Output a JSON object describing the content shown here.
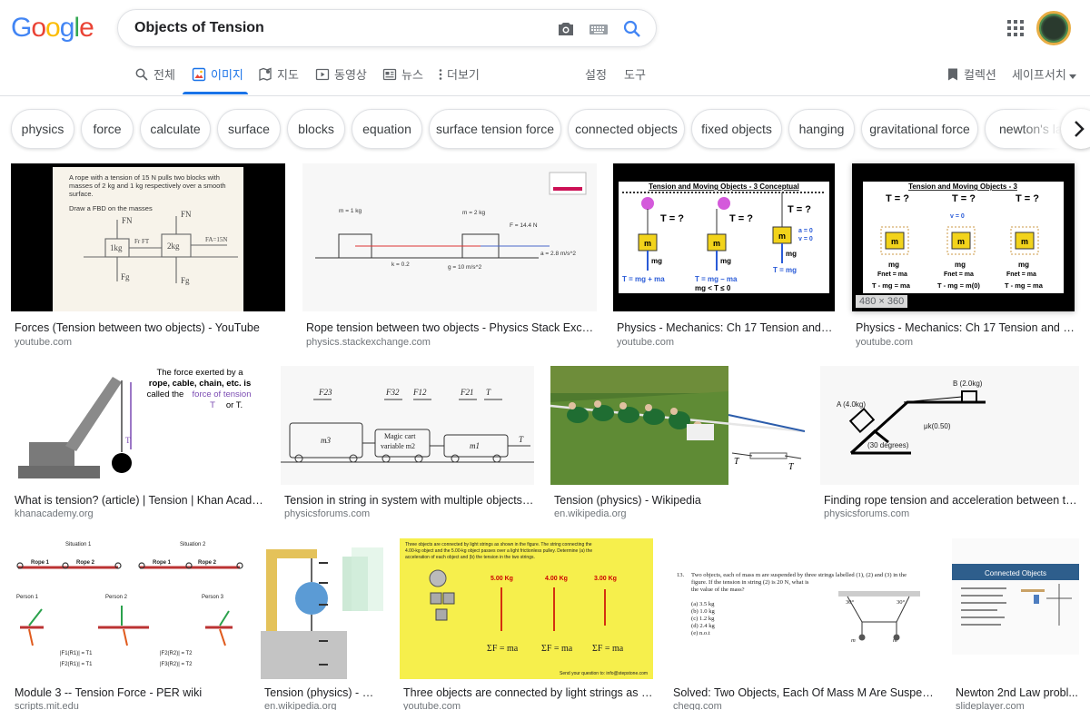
{
  "logo": {
    "text": "Google"
  },
  "search": {
    "query": "Objects of Tension"
  },
  "tabs": [
    {
      "label": "전체",
      "icon": "search-icon"
    },
    {
      "label": "이미지",
      "icon": "image-icon",
      "active": true
    },
    {
      "label": "지도",
      "icon": "map-icon"
    },
    {
      "label": "동영상",
      "icon": "video-icon"
    },
    {
      "label": "뉴스",
      "icon": "news-icon"
    },
    {
      "label": "더보기",
      "icon": "more-vert-icon"
    }
  ],
  "tools": {
    "settings": "설정",
    "tools": "도구",
    "collections": "컬렉션",
    "safesearch": "세이프서치"
  },
  "chips": [
    "physics",
    "force",
    "calculate",
    "surface",
    "blocks",
    "equation",
    "surface tension force",
    "connected objects",
    "fixed objects",
    "hanging",
    "gravitational force",
    "newton's law"
  ],
  "results": [
    {
      "title": "Forces (Tension between two objects) - YouTube",
      "source": "youtube.com",
      "text": {
        "line1": "A rope with a tension of 15 N pulls two blocks with",
        "line2": "masses of 2 kg and 1 kg respectively over a smooth",
        "line3": "surface.",
        "line4": "Draw a FBD on the masses",
        "fn": "FN",
        "fg": "Fg",
        "m1": "1kg",
        "m2": "2kg",
        "ft": "Fr  FT",
        "fa": "FA=15N"
      }
    },
    {
      "title": "Rope tension between two objects - Physics Stack Exchange",
      "source": "physics.stackexchange.com",
      "text": {
        "m1": "m = 1 kg",
        "m2": "m = 2 kg",
        "f": "F = 14.4 N",
        "k": "k = 0.2",
        "g": "g = 10 m/s^2",
        "a": "a = 2.8 m/s^2"
      }
    },
    {
      "title": "Physics - Mechanics: Ch 17 Tension and Wa...",
      "source": "youtube.com",
      "text": {
        "head": "Tension and Moving Objects - 3 Conceptual",
        "t": "T = ?",
        "m": "m",
        "mg": "mg",
        "a0": "a = 0",
        "v0": "v = 0",
        "e1": "T = mg + ma",
        "e2": "T = mg – ma",
        "e3": "mg < T ≤ 0",
        "e4": "T = mg"
      }
    },
    {
      "title": "Physics - Mechanics: Ch 17 Tension and Wa...",
      "source": "youtube.com",
      "dims": "480 × 360",
      "text": {
        "head": "Tension and Moving Objects - 3",
        "t": "T = ?",
        "m": "m",
        "mg": "mg",
        "fnet": "Fnet = ma",
        "e1": "T - mg = ma",
        "e2": "T - mg = m(0)",
        "e3": "T - mg = ma",
        "v0": "v = 0"
      }
    },
    {
      "title": "What is tension? (article) | Tension | Khan Academy",
      "source": "khanacademy.org",
      "text": {
        "l1": "The force exerted by a",
        "l2": "rope, cable, chain, etc. is",
        "l3": "called the",
        "l3b": "force of tension",
        "l4": "F",
        "l4b": "T",
        "l4c": "or T.",
        "t": "T"
      }
    },
    {
      "title": "Tension in string in system with multiple objects? | ...",
      "source": "physicsforums.com",
      "text": {
        "f23": "F23",
        "f32": "F32",
        "f12": "F12",
        "f21": "F21",
        "t": "T",
        "m3": "m3",
        "m2": "m2",
        "m1": "m1",
        "cart1": "Magic cart",
        "cart2": "variable m2"
      }
    },
    {
      "title": "Tension (physics) - Wikipedia",
      "source": "en.wikipedia.org",
      "text": {
        "t1": "T",
        "t2": "T"
      }
    },
    {
      "title": "Finding rope tension and acceleration between two...",
      "source": "physicsforums.com",
      "text": {
        "a": "A (4.0kg)",
        "b": "B (2.0kg)",
        "mu": "μk(0.50)",
        "ang": "(30 degrees)"
      }
    },
    {
      "title": "Module 3 -- Tension Force - PER wiki",
      "source": "scripts.mit.edu",
      "text": {
        "s1": "Situation 1",
        "s2": "Situation 2",
        "r1": "Rope 1",
        "r2": "Rope 2",
        "p1": "Person 1",
        "p2": "Person 2",
        "p3": "Person 3",
        "eq1": "|F1(R1)| = T1",
        "eq2": "|F2(R1)| = T1",
        "eq3": "|F2(R2)| = T2",
        "eq4": "|F3(R2)| = T2"
      }
    },
    {
      "title": "Tension (physics) - Wi...",
      "source": "en.wikipedia.org",
      "text": {}
    },
    {
      "title": "Three objects are connected by light strings as sh...",
      "source": "youtube.com",
      "text": {
        "l1": "Three objects are connected by light strings as shown in the figure. The string connecting the",
        "l2": "4.00-kg object and the 5.00-kg object passes over a light frictionless pulley. Determine (a) the",
        "l3": "acceleration of each object and (b) the tension in the two strings.",
        "k1": "5.00 Kg",
        "k2": "4.00 Kg",
        "k3": "3.00 Kg",
        "e1": "ΣF = ma",
        "e2": "ΣF = ma",
        "e3": "ΣF = ma",
        "tail": "Send your question to: info@stepstone.com"
      }
    },
    {
      "title": "Solved: Two Objects, Each Of Mass M Are Suspende...",
      "source": "chegg.com",
      "text": {
        "q": "13.",
        "l1": "Two objects, each of mass m are suspended by three strings labelled (1), (2) and (3) in the",
        "l2": "figure.  If the tension in string (2) is 20 N, what is",
        "l3": "the value of the mass?",
        "a": "(a) 3.5 kg",
        "b": "(b) 1.0 kg",
        "c": "(c) 1.2 kg",
        "d": "(d) 2.4 kg",
        "e": "(e) n.o.t",
        "ang": "30°",
        "m": "m"
      }
    },
    {
      "title": "Newton 2nd Law probl...",
      "source": "slideplayer.com",
      "text": {
        "head": "Connected Objects"
      }
    }
  ]
}
